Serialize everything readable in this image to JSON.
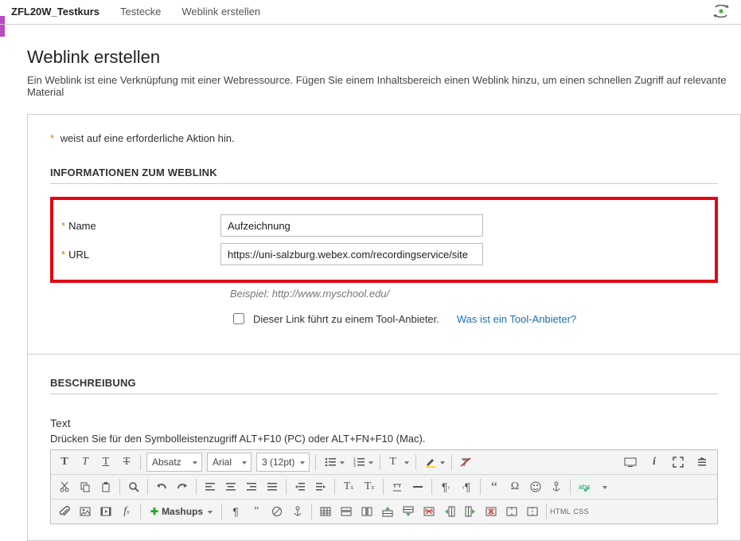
{
  "breadcrumb": {
    "course": "ZFL20W_Testkurs",
    "area": "Testecke",
    "current": "Weblink erstellen"
  },
  "page": {
    "title": "Weblink erstellen",
    "subtitle": "Ein Weblink ist eine Verknüpfung mit einer Webressource. Fügen Sie einem Inhaltsbereich einen Weblink hinzu, um einen schnellen Zugriff auf relevante Material"
  },
  "required_note": "weist auf eine erforderliche Aktion hin.",
  "section1_title": "INFORMATIONEN ZUM WEBLINK",
  "fields": {
    "name_label": "Name",
    "name_value": "Aufzeichnung",
    "url_label": "URL",
    "url_value": "https://uni-salzburg.webex.com/recordingservice/site",
    "url_example": "Beispiel: http://www.myschool.edu/",
    "tool_checkbox_label": "Dieser Link führt zu einem Tool-Anbieter.",
    "tool_help_link": "Was ist ein Tool-Anbieter?"
  },
  "section2_title": "BESCHREIBUNG",
  "editor": {
    "text_label": "Text",
    "hint": "Drücken Sie für den Symbolleistenzugriff ALT+F10 (PC) oder ALT+FN+F10 (Mac).",
    "para_select": "Absatz",
    "font_select": "Arial",
    "size_select": "3 (12pt)",
    "mashups_label": "Mashups",
    "html_label": "HTML",
    "css_label": "CSS"
  }
}
